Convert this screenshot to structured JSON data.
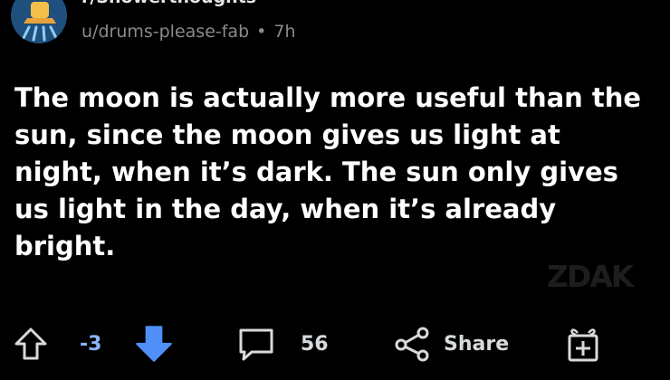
{
  "post": {
    "subreddit": "r/Showerthoughts",
    "author": "u/drums-please-fab",
    "separator": "•",
    "age": "7h",
    "body": "The moon is actually more useful than the sun, since the moon gives us light at night, when it’s dark. The sun only gives us light in the day, when it’s already bright."
  },
  "actions": {
    "vote_count": "-3",
    "comment_count": "56",
    "share_label": "Share"
  },
  "watermark": "ZDAK",
  "icons": {
    "avatar": "shower-head-icon",
    "upvote": "arrow-up-outline-icon",
    "downvote": "arrow-down-filled-icon",
    "comments": "comment-bubble-icon",
    "share": "share-nodes-icon",
    "award": "gift-icon"
  },
  "colors": {
    "background": "#000000",
    "downvote_active": "#4f8ff7",
    "vote_count": "#8ab4f8",
    "meta_text": "#8a8a8a",
    "avatar_bg": "#1f4f7d"
  }
}
